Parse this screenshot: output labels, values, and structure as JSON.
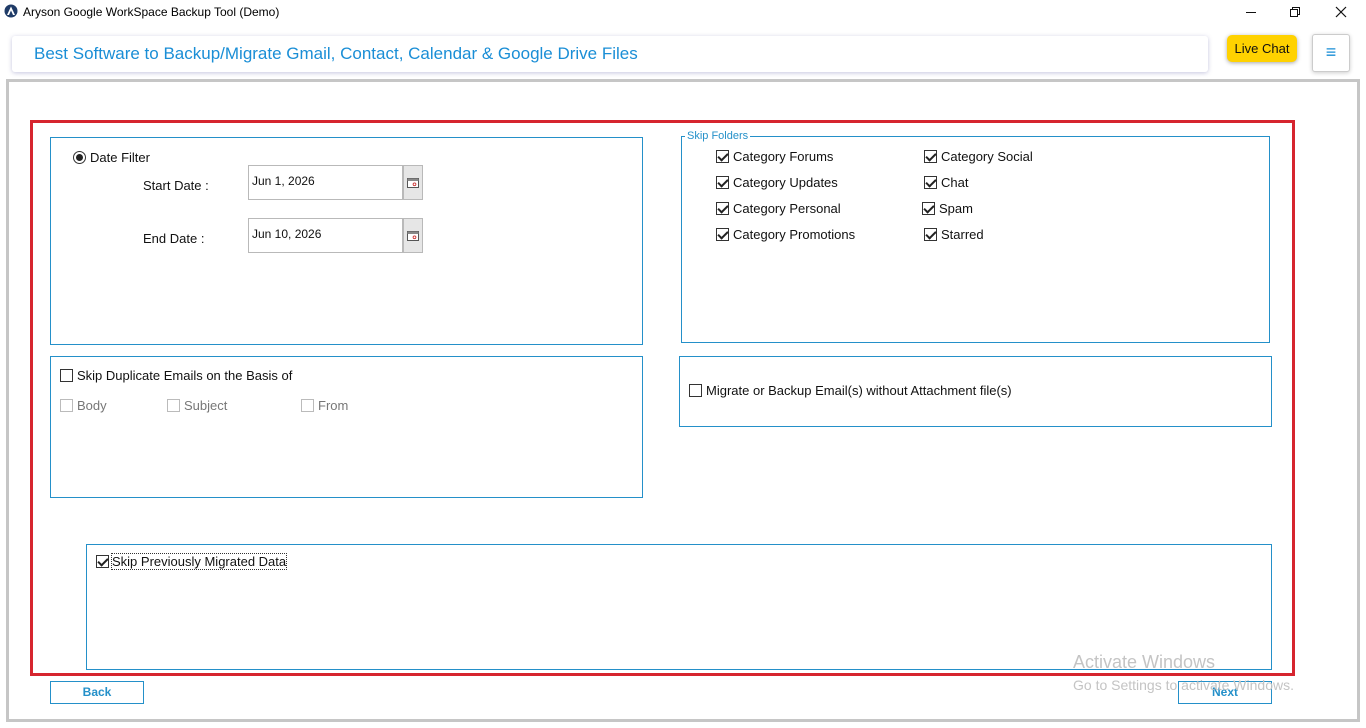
{
  "window": {
    "title": "Aryson Google WorkSpace Backup Tool (Demo)"
  },
  "header": {
    "title": "Best Software to Backup/Migrate Gmail, Contact, Calendar & Google Drive Files",
    "live_chat": "Live Chat",
    "menu_glyph": "≡"
  },
  "date_filter": {
    "label": "Date Filter",
    "start_label": "Start Date :",
    "start_value": "Jun 1, 2026",
    "end_label": "End Date :",
    "end_value": "Jun 10, 2026"
  },
  "skip_folders": {
    "legend": "Skip Folders",
    "items": [
      {
        "label": "Category Forums",
        "checked": true
      },
      {
        "label": "Category Updates",
        "checked": true
      },
      {
        "label": "Category Personal",
        "checked": true
      },
      {
        "label": "Category Promotions",
        "checked": true
      },
      {
        "label": "Category Social",
        "checked": true
      },
      {
        "label": "Chat",
        "checked": true
      },
      {
        "label": "Spam",
        "checked": true
      },
      {
        "label": "Starred",
        "checked": true
      }
    ]
  },
  "skip_duplicates": {
    "label": "Skip Duplicate Emails on the Basis of",
    "options": [
      "Body",
      "Subject",
      "From"
    ]
  },
  "attachments": {
    "label": "Migrate or Backup Email(s) without Attachment file(s)"
  },
  "skip_previous": {
    "label": "Skip Previously Migrated Data"
  },
  "footer": {
    "back": "Back",
    "next": "Next"
  },
  "watermark": {
    "line1": "Activate Windows",
    "line2": "Go to Settings to activate Windows."
  },
  "colors": {
    "accent": "#2490c9",
    "highlight": "#d6252f",
    "live_chat_bg": "#ffd200"
  }
}
